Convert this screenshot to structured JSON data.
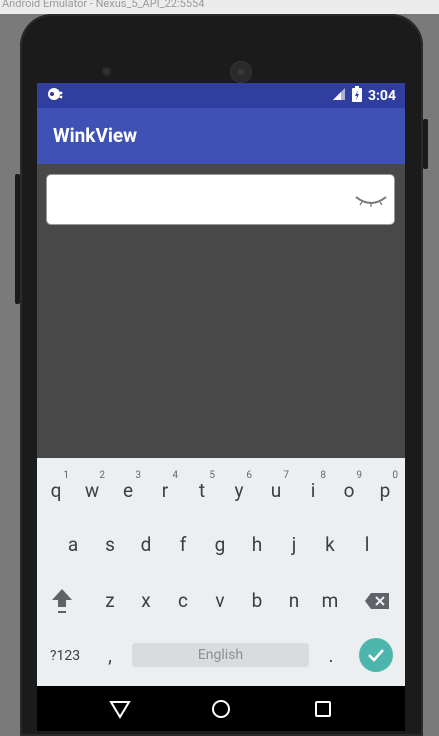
{
  "emulator": {
    "title": "Android Emulator - Nexus_5_API_22:5554"
  },
  "statusbar": {
    "time": "3:04"
  },
  "app": {
    "title": "WinkView"
  },
  "input": {
    "value": "",
    "placeholder": ""
  },
  "keyboard": {
    "row1": [
      {
        "k": "q",
        "n": "1"
      },
      {
        "k": "w",
        "n": "2"
      },
      {
        "k": "e",
        "n": "3"
      },
      {
        "k": "r",
        "n": "4"
      },
      {
        "k": "t",
        "n": "5"
      },
      {
        "k": "y",
        "n": "6"
      },
      {
        "k": "u",
        "n": "7"
      },
      {
        "k": "i",
        "n": "8"
      },
      {
        "k": "o",
        "n": "9"
      },
      {
        "k": "p",
        "n": "0"
      }
    ],
    "row2": [
      "a",
      "s",
      "d",
      "f",
      "g",
      "h",
      "j",
      "k",
      "l"
    ],
    "row3": [
      "z",
      "x",
      "c",
      "v",
      "b",
      "n",
      "m"
    ],
    "symbols_label": "?123",
    "comma": ",",
    "space_label": "English",
    "period": "."
  },
  "colors": {
    "statusbar": "#303e9f",
    "toolbar": "#3f51b5",
    "accent_enter": "#4db6ac",
    "screen_bg": "#484848"
  }
}
